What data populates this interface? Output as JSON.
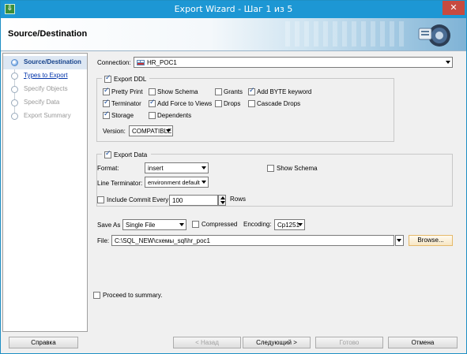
{
  "window": {
    "title": "Export Wizard - Шаг 1 из 5",
    "close_glyph": "✕",
    "app_icon": "export-wizard-icon"
  },
  "header": {
    "title": "Source/Destination"
  },
  "sidebar": {
    "steps": [
      {
        "label": "Source/Destination",
        "state": "active"
      },
      {
        "label": "Types to Export",
        "state": "link"
      },
      {
        "label": "Specify Objects",
        "state": "disabled"
      },
      {
        "label": "Specify Data",
        "state": "disabled"
      },
      {
        "label": "Export Summary",
        "state": "disabled"
      }
    ]
  },
  "connection": {
    "label": "Connection:",
    "value": "HR_POC1",
    "icon": "database-connection-icon"
  },
  "export_ddl": {
    "label": "Export DDL",
    "checked": true,
    "options": {
      "pretty_print": {
        "label": "Pretty Print",
        "checked": true
      },
      "show_schema": {
        "label": "Show Schema",
        "checked": false
      },
      "grants": {
        "label": "Grants",
        "checked": false
      },
      "add_byte_keyword": {
        "label": "Add BYTE keyword",
        "checked": true
      },
      "terminator": {
        "label": "Terminator",
        "checked": true
      },
      "add_force_to_views": {
        "label": "Add Force to Views",
        "checked": true
      },
      "drops": {
        "label": "Drops",
        "checked": false
      },
      "cascade_drops": {
        "label": "Cascade Drops",
        "checked": false
      },
      "storage": {
        "label": "Storage",
        "checked": true
      },
      "dependents": {
        "label": "Dependents",
        "checked": false
      }
    },
    "version_label": "Version:",
    "version_value": "COMPATIBLE"
  },
  "export_data": {
    "label": "Export Data",
    "checked": true,
    "format_label": "Format:",
    "format_value": "insert",
    "show_schema_label": "Show Schema",
    "show_schema_checked": false,
    "line_terminator_label": "Line Terminator:",
    "line_terminator_value": "environment default",
    "include_commit_label": "Include Commit Every",
    "include_commit_checked": false,
    "commit_rows_value": "100",
    "rows_label": "Rows"
  },
  "save": {
    "save_as_label": "Save As",
    "save_as_value": "Single File",
    "compressed_label": "Compressed",
    "compressed_checked": false,
    "encoding_label": "Encoding:",
    "encoding_value": "Cp1251",
    "file_label": "File:",
    "file_value": "C:\\SQL_NEW\\схемы_sql\\hr_poc1",
    "browse_label": "Browse..."
  },
  "proceed": {
    "label": "Proceed to summary.",
    "checked": false
  },
  "buttons": {
    "help": "Справка",
    "back": "< Назад",
    "next": "Следующий >",
    "finish": "Готово",
    "cancel": "Отмена"
  }
}
